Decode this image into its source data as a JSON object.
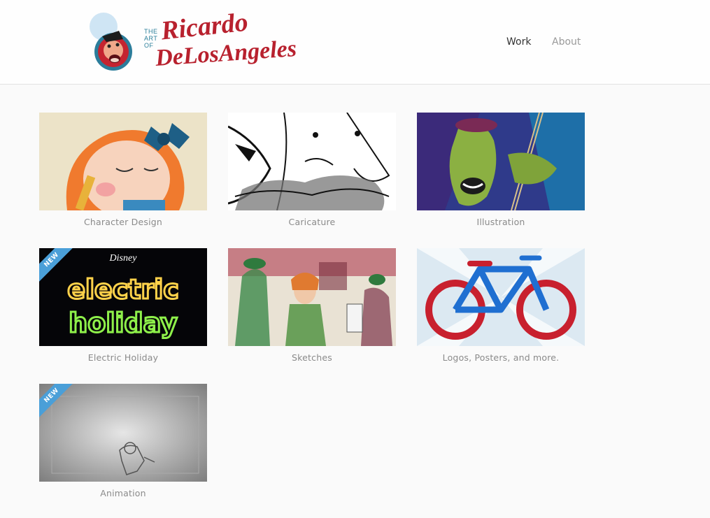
{
  "header": {
    "logo": {
      "the": "THE",
      "art": "ART",
      "of": "OF",
      "first_name": "Ricardo",
      "last_name": "DeLosAngeles"
    },
    "nav": [
      {
        "label": "Work",
        "active": true
      },
      {
        "label": "About",
        "active": false
      }
    ]
  },
  "colors": {
    "ribbon": "#4a9fd8",
    "logo_red": "#b8212e",
    "logo_blue": "#2a7f9a",
    "caption": "#8a8a8a"
  },
  "gallery": [
    {
      "caption": "Character Design",
      "badge": ""
    },
    {
      "caption": "Caricature",
      "badge": ""
    },
    {
      "caption": "Illustration",
      "badge": ""
    },
    {
      "caption": "Electric Holiday",
      "badge": "NEW",
      "image_text": {
        "brand": "Disney",
        "line1": "electric",
        "line2": "holiday"
      }
    },
    {
      "caption": "Sketches",
      "badge": ""
    },
    {
      "caption": "Logos, Posters, and more.",
      "badge": ""
    },
    {
      "caption": "Animation",
      "badge": "NEW"
    }
  ]
}
